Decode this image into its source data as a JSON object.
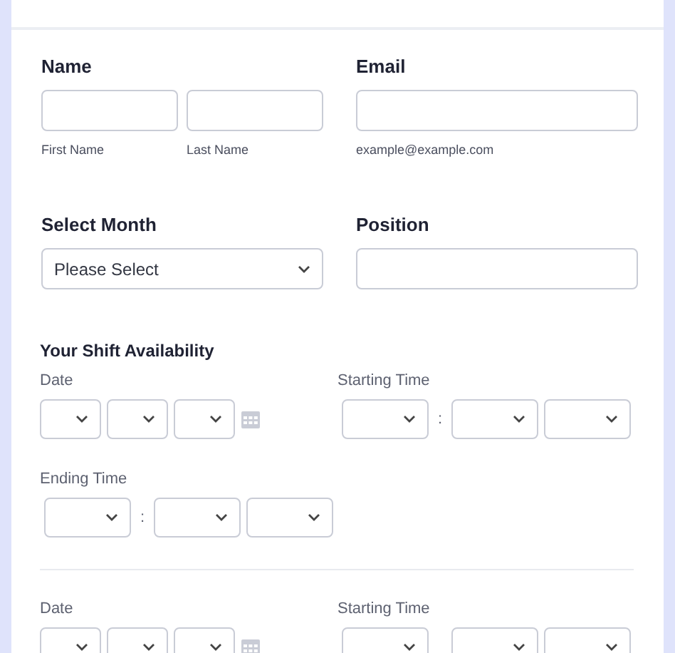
{
  "name": {
    "label": "Name",
    "sublabels": [
      "First Name",
      "Last Name"
    ]
  },
  "email": {
    "label": "Email",
    "sublabel": "example@example.com"
  },
  "month": {
    "label": "Select Month",
    "value": "Please Select"
  },
  "position": {
    "label": "Position"
  },
  "shift": {
    "title": "Your Shift Availability",
    "entries": [
      {
        "date_label": "Date",
        "start_label": "Starting Time",
        "separator": ":",
        "end_label": "Ending Time"
      },
      {
        "date_label": "Date",
        "start_label": "Starting Time"
      }
    ]
  }
}
